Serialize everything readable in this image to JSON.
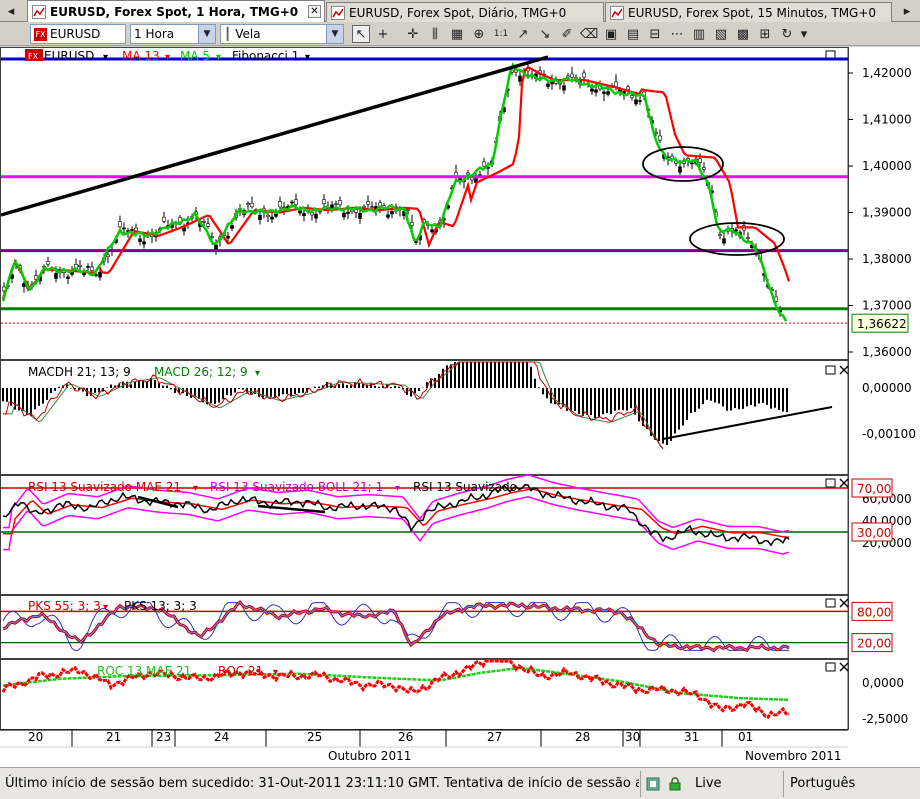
{
  "tabs": [
    {
      "label": "EURUSD, Forex Spot, 1 Hora, TMG+0",
      "active": true
    },
    {
      "label": "EURUSD, Forex Spot, Diário, TMG+0",
      "active": false
    },
    {
      "label": "EURUSD, Forex Spot, 15 Minutos, TMG+0",
      "active": false
    }
  ],
  "toolbar": {
    "symbol": "EURUSD",
    "period": "1 Hora",
    "chart_style": "Vela",
    "dd_glyph": "▼",
    "tool_glyphs": [
      "↖",
      "+",
      "✛",
      "⫼",
      "▦",
      "⊕",
      "1:1",
      "↗",
      "↘",
      "✐",
      "⌫",
      "▣",
      "▤",
      "⊟",
      "⋯",
      "▥",
      "▧",
      "▩",
      "⊞",
      "↻"
    ]
  },
  "legend": {
    "symbol": "EURUSD",
    "ma13": "MA 13",
    "ma5": "MA 5",
    "fib": "Fibonacci 1"
  },
  "colors": {
    "ma13": "#ff0000",
    "ma5": "#00cc00",
    "fib_upper": "#ff00ff",
    "fib_lower": "#800080",
    "fib_green": "#008000",
    "trend": "#000000",
    "blue": "#0000cc"
  },
  "price_axis": {
    "ticks": [
      "1,42000",
      "1,41000",
      "1,40000",
      "1,39000",
      "1,38000",
      "1,37000",
      "1,36000"
    ],
    "current": "1,36622"
  },
  "macd": {
    "label1": "MACDH 21; 13; 9",
    "label2": "MACD 26; 12; 9",
    "ticks": [
      "0,00000",
      "-0,00100"
    ]
  },
  "rsi": {
    "label1": "RSI 13 Suavizado MAE 21",
    "label2": "RSI 13 Suavizado BOLL 21; 1",
    "label3": "RSI 13 Suavizado",
    "ticks": [
      "60,0000",
      "40,0000",
      "20,0000"
    ],
    "level_high": "70,00",
    "level_low": "30,00"
  },
  "pks": {
    "label1": "PKS 55; 3; 3",
    "label2": "PKS 13; 3; 3",
    "level_high": "80,00",
    "level_low": "20,00"
  },
  "roc": {
    "label1": "ROC 13 MAE 21",
    "label2": "ROC 21",
    "ticks": [
      "0,0000",
      "-2,5000"
    ]
  },
  "time_axis": {
    "days": [
      "20",
      "21",
      "23",
      "24",
      "25",
      "26",
      "27",
      "28",
      "30",
      "31",
      "01"
    ],
    "month1": "Outubro 2011",
    "month2": "Novembro 2011"
  },
  "status": {
    "message": "Último início de sessão bem sucedido: 31-Out-2011 23:11:10 GMT. Tentativa de início de sessão ant",
    "live": "Live",
    "language": "Português"
  }
}
